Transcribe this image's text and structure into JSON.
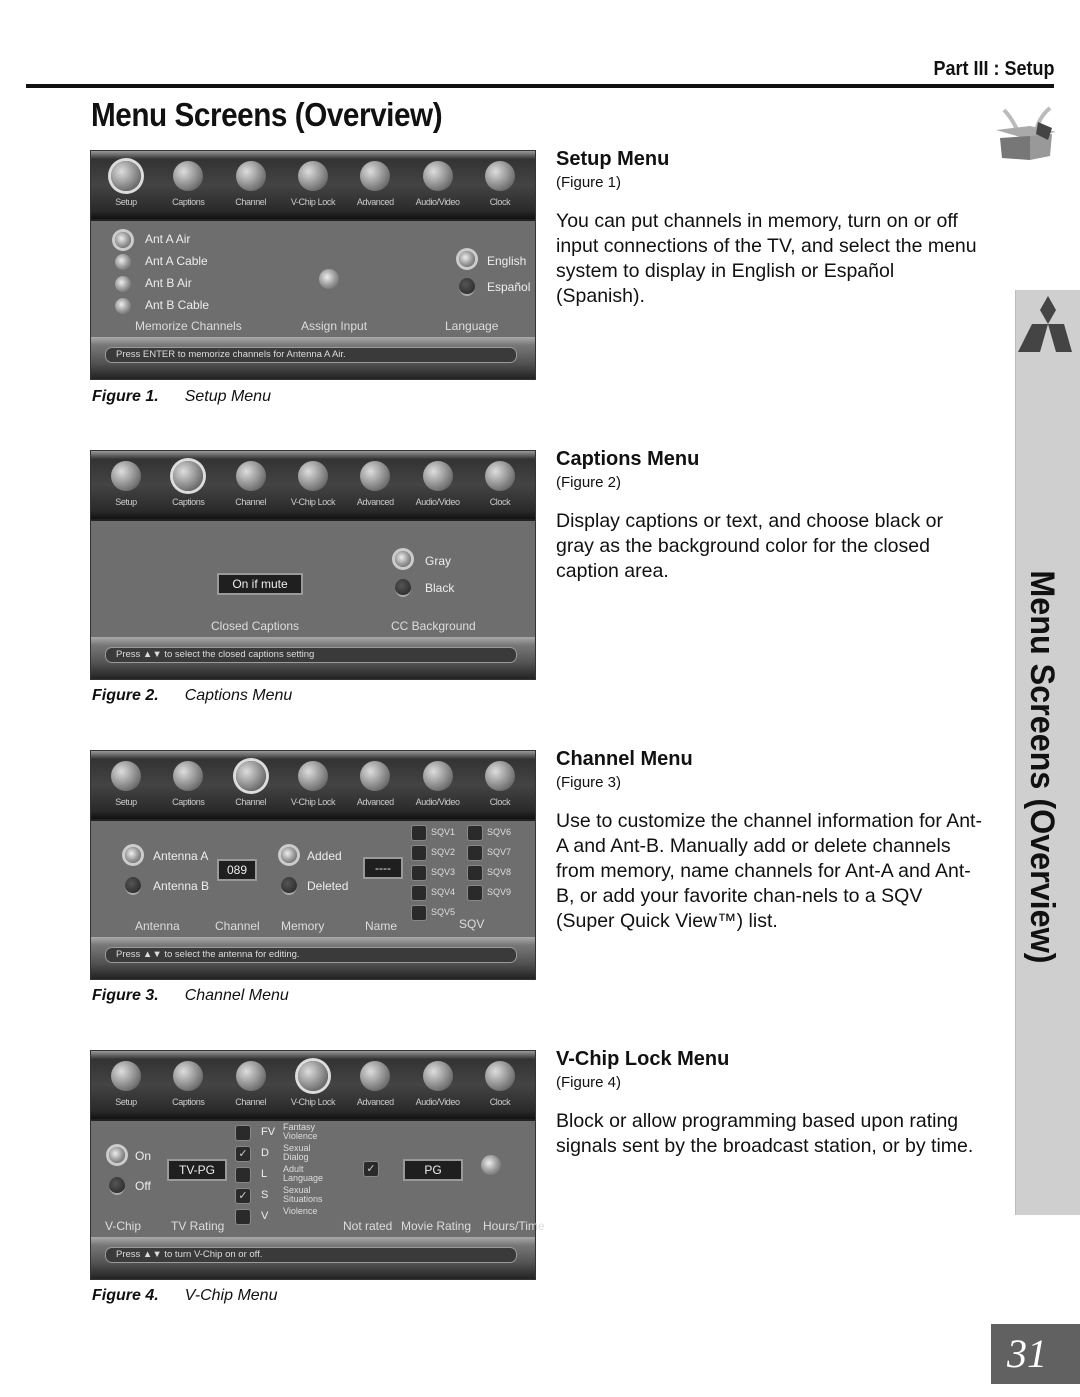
{
  "header": {
    "part_label": "Part III : Setup",
    "title": "Menu Screens (Overview)",
    "icon": "open-box-icon"
  },
  "sidebar": {
    "logo": "mitsubishi-logo-icon",
    "title": "Menu Screens (Overview)"
  },
  "page_number": "31",
  "menu_tabs": [
    "Setup",
    "Captions",
    "Channel",
    "V-Chip Lock",
    "Advanced",
    "Audio/Video",
    "Clock"
  ],
  "figures": [
    {
      "caption_label": "Figure 1.",
      "caption_text": "Setup Menu",
      "active_tab": "Setup",
      "setup": {
        "memorize_options": [
          "Ant A Air",
          "Ant A Cable",
          "Ant B Air",
          "Ant B Cable"
        ],
        "memorize_header": "Memorize Channels",
        "assign_header": "Assign Input",
        "language_options": [
          "English",
          "Español"
        ],
        "language_selected": "English",
        "language_header": "Language"
      },
      "status_text": "Press ENTER to memorize channels for Antenna A Air."
    },
    {
      "caption_label": "Figure 2.",
      "caption_text": "Captions Menu",
      "active_tab": "Captions",
      "captions": {
        "cc_value": "On if mute",
        "cc_header": "Closed Captions",
        "bg_options": [
          "Gray",
          "Black"
        ],
        "bg_selected": "Gray",
        "bg_header": "CC Background"
      },
      "status_text": "Press ▲▼ to select the closed captions setting"
    },
    {
      "caption_label": "Figure 3.",
      "caption_text": "Channel Menu",
      "active_tab": "Channel",
      "channel": {
        "antenna_options": [
          "Antenna A",
          "Antenna B"
        ],
        "antenna_selected": "Antenna A",
        "antenna_header": "Antenna",
        "channel_value": "089",
        "channel_header": "Channel",
        "memory_options": [
          "Added",
          "Deleted"
        ],
        "memory_selected": "Added",
        "memory_header": "Memory",
        "name_value": "----",
        "name_header": "Name",
        "sqv_items": [
          "SQV1",
          "SQV2",
          "SQV3",
          "SQV4",
          "SQV5",
          "SQV6",
          "SQV7",
          "SQV8",
          "SQV9"
        ],
        "sqv_header": "SQV"
      },
      "status_text": "Press ▲▼ to select the antenna for editing."
    },
    {
      "caption_label": "Figure 4.",
      "caption_text": "V-Chip Menu",
      "active_tab": "V-Chip Lock",
      "vchip": {
        "vchip_options": [
          "On",
          "Off"
        ],
        "vchip_selected": "On",
        "vchip_header": "V-Chip",
        "tv_rating_value": "TV-PG",
        "tv_rating_header": "TV Rating",
        "content_items": [
          {
            "code": "FV",
            "desc": "Fantasy Violence",
            "checked": false
          },
          {
            "code": "D",
            "desc": "Sexual Dialog",
            "checked": true
          },
          {
            "code": "L",
            "desc": "Adult Language",
            "checked": false
          },
          {
            "code": "S",
            "desc": "Sexual Situations",
            "checked": true
          },
          {
            "code": "V",
            "desc": "Violence",
            "checked": false
          }
        ],
        "not_rated_header": "Not rated",
        "not_rated_checked": true,
        "movie_rating_value": "PG",
        "movie_rating_header": "Movie Rating",
        "hours_header": "Hours/Time"
      },
      "status_text": "Press ▲▼ to turn V-Chip on or off."
    }
  ],
  "sections": [
    {
      "title": "Setup Menu",
      "figure_ref": "(Figure 1)",
      "body": "You can put channels in memory, turn on or off input connections of the TV, and select the menu system to display in English or Español (Spanish)."
    },
    {
      "title": "Captions Menu",
      "figure_ref": "(Figure 2)",
      "body": "Display captions or text, and choose black or gray as the background color for the closed caption area."
    },
    {
      "title": "Channel Menu",
      "figure_ref": "(Figure 3)",
      "body": "Use to customize the channel information for Ant-A and Ant-B. Manually add or delete channels from memory, name channels for Ant-A and Ant-B, or add your favorite chan-nels to a SQV (Super Quick View™) list."
    },
    {
      "title": "V-Chip Lock Menu",
      "figure_ref": "(Figure 4)",
      "body": "Block or allow programming based upon rating signals sent by the broadcast station, or by time."
    }
  ]
}
